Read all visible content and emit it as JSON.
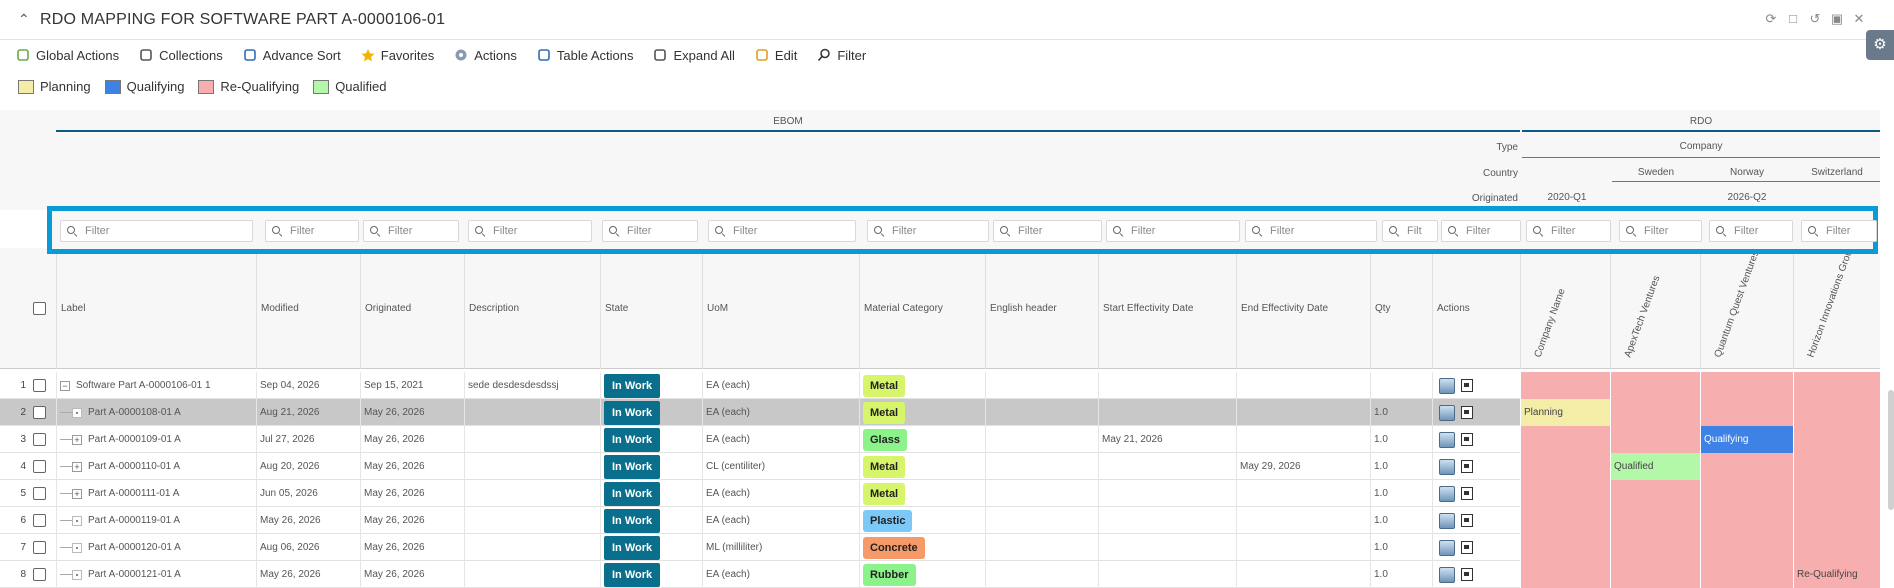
{
  "window": {
    "title": "RDO MAPPING FOR SOFTWARE PART A-0000106-01"
  },
  "toolbar": [
    {
      "label": "Global Actions",
      "icon": "global-actions-icon"
    },
    {
      "label": "Collections",
      "icon": "clipboard-icon"
    },
    {
      "label": "Advance Sort",
      "icon": "sort-icon"
    },
    {
      "label": "Favorites",
      "icon": "star-icon"
    },
    {
      "label": "Actions",
      "icon": "actions-icon"
    },
    {
      "label": "Table Actions",
      "icon": "table-icon"
    },
    {
      "label": "Expand All",
      "icon": "expand-icon"
    },
    {
      "label": "Edit",
      "icon": "edit-icon"
    },
    {
      "label": "Filter",
      "icon": "search-icon"
    }
  ],
  "legend": [
    {
      "label": "Planning",
      "color": "#f3eda8"
    },
    {
      "label": "Qualifying",
      "color": "#3f82e6"
    },
    {
      "label": "Re-Qualifying",
      "color": "#f7aeae"
    },
    {
      "label": "Qualified",
      "color": "#b3f7a8"
    }
  ],
  "groups": {
    "ebom": "EBOM",
    "rdo": "RDO",
    "type_label": "Type",
    "type_value": "Company",
    "country_label": "Country",
    "countries": [
      "Sweden",
      "Norway",
      "Switzerland"
    ],
    "originated_label": "Originated",
    "originated_values": [
      "2020-Q1",
      "2026-Q2"
    ]
  },
  "filter_placeholder": "Filter",
  "filter_short": "Filt",
  "columns": {
    "label": "Label",
    "modified": "Modified",
    "originated": "Originated",
    "description": "Description",
    "state": "State",
    "uom": "UoM",
    "material": "Material Category",
    "english": "English header",
    "start_eff": "Start Effectivity Date",
    "end_eff": "End Effectivity Date",
    "qty": "Qty",
    "actions": "Actions",
    "rdo": [
      "Company Name",
      "ApexTech Ventures",
      "Quantum Quest Ventures",
      "Horizon Innovations Group"
    ]
  },
  "rows": [
    {
      "num": "1",
      "label": "Software Part A-0000106-01 1",
      "modified": "Sep 04, 2026",
      "originated": "Sep 15, 2021",
      "description": "sede desdesdesdssj",
      "state": "In Work",
      "uom": "EA (each)",
      "material": "Metal",
      "material_color": "#d6f56a",
      "start": "",
      "end": "",
      "qty": "",
      "rdo": [
        "",
        "",
        "",
        ""
      ]
    },
    {
      "num": "2",
      "label": "Part A-0000108-01 A",
      "modified": "Aug 21, 2026",
      "originated": "May 26, 2026",
      "description": "",
      "state": "In Work",
      "uom": "EA (each)",
      "material": "Metal",
      "material_color": "#d6f56a",
      "start": "",
      "end": "",
      "qty": "1.0",
      "rdo": [
        "Planning",
        "",
        "",
        ""
      ]
    },
    {
      "num": "3",
      "label": "Part A-0000109-01 A",
      "modified": "Jul 27, 2026",
      "originated": "May 26, 2026",
      "description": "",
      "state": "In Work",
      "uom": "EA (each)",
      "material": "Glass",
      "material_color": "#8cf28a",
      "start": "May 21, 2026",
      "end": "",
      "qty": "1.0",
      "rdo": [
        "",
        "",
        "Qualifying",
        ""
      ]
    },
    {
      "num": "4",
      "label": "Part A-0000110-01 A",
      "modified": "Aug 20, 2026",
      "originated": "May 26, 2026",
      "description": "",
      "state": "In Work",
      "uom": "CL (centiliter)",
      "material": "Metal",
      "material_color": "#d6f56a",
      "start": "",
      "end": "May 29, 2026",
      "qty": "1.0",
      "rdo": [
        "",
        "Qualified",
        "",
        ""
      ]
    },
    {
      "num": "5",
      "label": "Part A-0000111-01 A",
      "modified": "Jun 05, 2026",
      "originated": "May 26, 2026",
      "description": "",
      "state": "In Work",
      "uom": "EA (each)",
      "material": "Metal",
      "material_color": "#d6f56a",
      "start": "",
      "end": "",
      "qty": "1.0",
      "rdo": [
        "",
        "",
        "",
        ""
      ]
    },
    {
      "num": "6",
      "label": "Part A-0000119-01 A",
      "modified": "May 26, 2026",
      "originated": "May 26, 2026",
      "description": "",
      "state": "In Work",
      "uom": "EA (each)",
      "material": "Plastic",
      "material_color": "#7cc8f7",
      "start": "",
      "end": "",
      "qty": "1.0",
      "rdo": [
        "",
        "",
        "",
        ""
      ]
    },
    {
      "num": "7",
      "label": "Part A-0000120-01 A",
      "modified": "Aug 06, 2026",
      "originated": "May 26, 2026",
      "description": "",
      "state": "In Work",
      "uom": "ML (milliliter)",
      "material": "Concrete",
      "material_color": "#f79a6a",
      "start": "",
      "end": "",
      "qty": "1.0",
      "rdo": [
        "",
        "",
        "",
        ""
      ]
    },
    {
      "num": "8",
      "label": "Part A-0000121-01 A",
      "modified": "May 26, 2026",
      "originated": "May 26, 2026",
      "description": "",
      "state": "In Work",
      "uom": "EA (each)",
      "material": "Rubber",
      "material_color": "#8cf28a",
      "start": "",
      "end": "",
      "qty": "1.0",
      "rdo": [
        "",
        "",
        "",
        "Re-Qualifying"
      ]
    }
  ],
  "row_tree": [
    "minus",
    "leaf",
    "plus",
    "plus",
    "plus",
    "leaf",
    "leaf",
    "leaf"
  ],
  "rdo_colors": {
    "planning": "#f3eda8",
    "qualifying": "#3f82e6",
    "requalifying": "#f7aeae",
    "qualified": "#b3f7a8"
  }
}
